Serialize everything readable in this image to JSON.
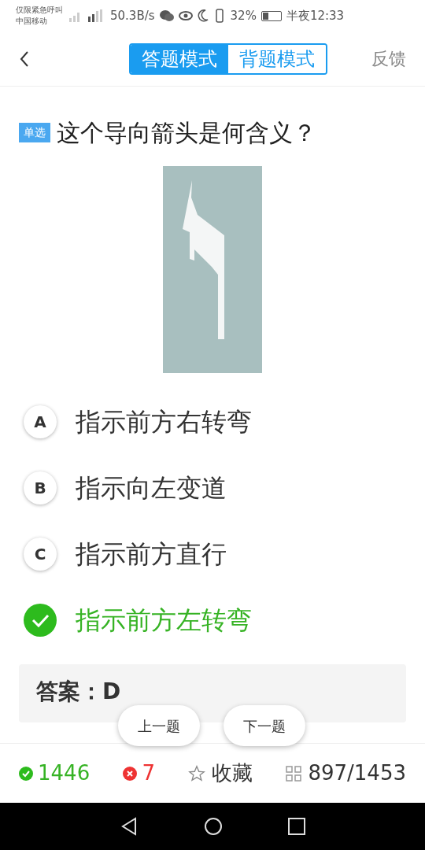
{
  "status_bar": {
    "notice": "仅限紧急呼叫",
    "carrier": "中国移动",
    "speed": "50.3B/s",
    "battery": "32%",
    "time": "半夜12:33"
  },
  "header": {
    "tabs": [
      {
        "label": "答题模式",
        "selected": true
      },
      {
        "label": "背题模式",
        "selected": false
      }
    ],
    "feedback": "反馈"
  },
  "question": {
    "tag": "单选",
    "text": "这个导向箭头是何含义？"
  },
  "options": [
    {
      "kind": "letter",
      "letter": "A",
      "text": "指示前方右转弯"
    },
    {
      "kind": "letter",
      "letter": "B",
      "text": "指示向左变道"
    },
    {
      "kind": "letter",
      "letter": "C",
      "text": "指示前方直行"
    },
    {
      "kind": "correct",
      "text": "指示前方左转弯"
    }
  ],
  "answer": "答案：D",
  "nav_buttons": [
    "上一题",
    "下一题"
  ],
  "footer": {
    "correct": "1446",
    "wrong": "7",
    "favorite": "收藏",
    "progress": "897/1453"
  }
}
